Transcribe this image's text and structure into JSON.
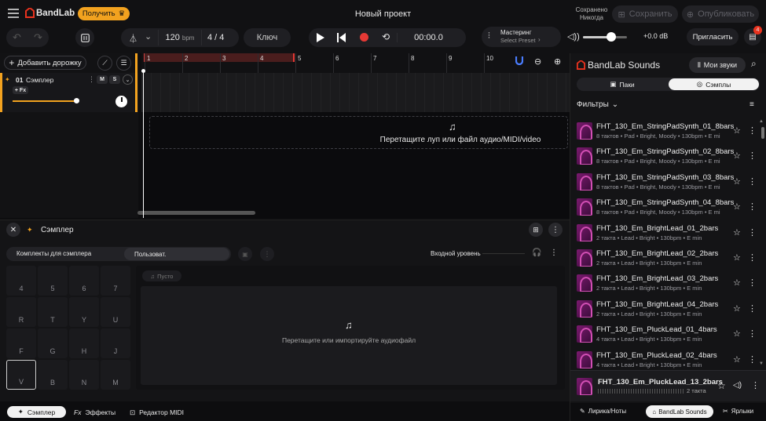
{
  "header": {
    "brand": "BandLab",
    "get_button": "Получить",
    "project_title": "Новый проект",
    "saved_label": "Сохранено",
    "saved_value": "Никогда",
    "save_button": "Сохранить",
    "publish_button": "Опубликовать"
  },
  "toolbar": {
    "tempo": "120",
    "tempo_unit": "bpm",
    "time_signature": "4 / 4",
    "key_button": "Ключ",
    "time_display": "00:00.0",
    "mastering_title": "Мастеринг",
    "mastering_sub": "Select Preset",
    "volume_db": "+0.0 dB",
    "invite_button": "Пригласить",
    "notification_count": "4"
  },
  "tracks": {
    "add_track": "Добавить дорожку",
    "track_number": "01",
    "track_name": "Сэмплер",
    "mute": "M",
    "solo": "S",
    "fx": "+ Fx",
    "drop_hint": "Перетащите луп или файл аудио/MIDI/video",
    "ruler_marks": [
      "1",
      "2",
      "3",
      "4",
      "5",
      "6",
      "7",
      "8",
      "9",
      "10"
    ]
  },
  "sampler": {
    "title": "Сэмплер",
    "tab_kits": "Комплекты для сэмплера",
    "tab_user": "Пользоват.",
    "input_level": "Входной уровень",
    "empty_label": "Пусто",
    "drop_hint": "Перетащите или импортируйте аудиофайл",
    "pads": [
      [
        "4",
        "5",
        "6",
        "7"
      ],
      [
        "R",
        "T",
        "Y",
        "U"
      ],
      [
        "F",
        "G",
        "H",
        "J"
      ],
      [
        "V",
        "B",
        "N",
        "M"
      ]
    ]
  },
  "bottom_tabs": {
    "sampler": "Сэмплер",
    "effects": "Эффекты",
    "midi": "Редактор MIDI"
  },
  "sounds": {
    "title": "BandLab Sounds",
    "my_sounds": "Мои звуки",
    "tab_packs": "Паки",
    "tab_samples": "Сэмплы",
    "filters": "Фильтры",
    "items": [
      {
        "title": "FHT_130_Em_StringPadSynth_01_8bars",
        "sub": "8 тактов • Pad • Bright, Moody • 130bpm • E mi"
      },
      {
        "title": "FHT_130_Em_StringPadSynth_02_8bars",
        "sub": "8 тактов • Pad • Bright, Moody • 130bpm • E mi"
      },
      {
        "title": "FHT_130_Em_StringPadSynth_03_8bars",
        "sub": "8 тактов • Pad • Bright, Moody • 130bpm • E mi"
      },
      {
        "title": "FHT_130_Em_StringPadSynth_04_8bars",
        "sub": "8 тактов • Pad • Bright, Moody • 130bpm • E mi"
      },
      {
        "title": "FHT_130_Em_BrightLead_01_2bars",
        "sub": "2 такта • Lead • Bright • 130bpm • E min"
      },
      {
        "title": "FHT_130_Em_BrightLead_02_2bars",
        "sub": "2 такта • Lead • Bright • 130bpm • E min"
      },
      {
        "title": "FHT_130_Em_BrightLead_03_2bars",
        "sub": "2 такта • Lead • Bright • 130bpm • E min"
      },
      {
        "title": "FHT_130_Em_BrightLead_04_2bars",
        "sub": "2 такта • Lead • Bright • 130bpm • E min"
      },
      {
        "title": "FHT_130_Em_PluckLead_01_4bars",
        "sub": "4 такта • Lead • Bright • 130bpm • E min"
      },
      {
        "title": "FHT_130_Em_PluckLead_02_4bars",
        "sub": "4 такта • Lead • Bright • 130bpm • E min"
      }
    ],
    "now_playing_title": "FHT_130_Em_PluckLead_13_2bars",
    "now_playing_sub": "2 такта"
  },
  "right_tabs": {
    "lyrics": "Лирика/Ноты",
    "sounds": "BandLab Sounds",
    "labels": "Ярлыки"
  },
  "colors": {
    "accent": "#f2a21f",
    "brand_red": "#e8321e",
    "record": "#e53935",
    "ruler_loop": "#4a1d1d"
  }
}
